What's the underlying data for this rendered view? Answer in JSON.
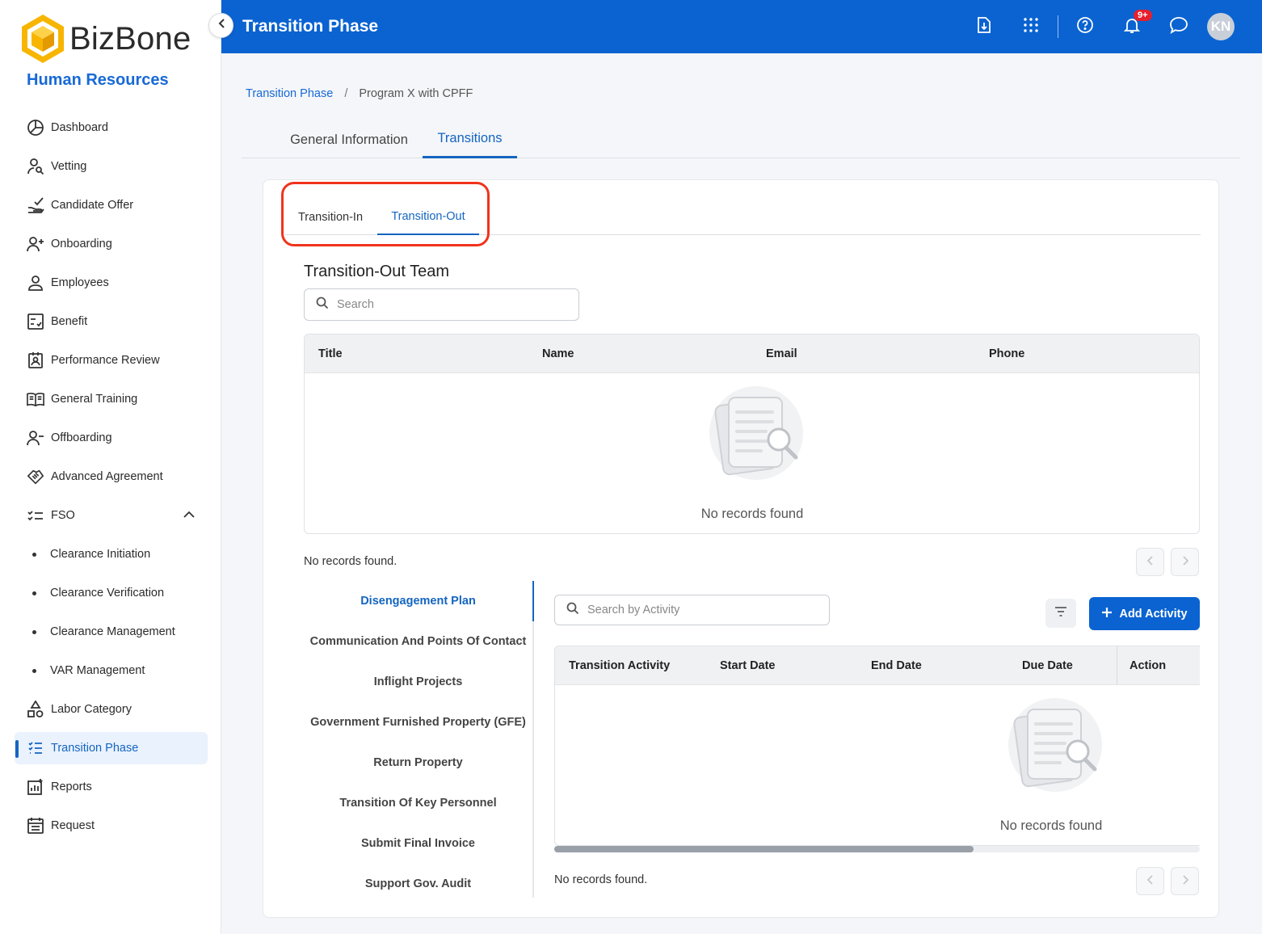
{
  "app": {
    "brand": "BizBone",
    "module": "Human Resources",
    "page_title": "Transition Phase",
    "user_initials": "KN",
    "notification_count": "9+"
  },
  "sidebar": {
    "items": [
      {
        "label": "Dashboard",
        "icon": "dashboard-icon"
      },
      {
        "label": "Vetting",
        "icon": "user-search-icon"
      },
      {
        "label": "Candidate Offer",
        "icon": "hand-check-icon"
      },
      {
        "label": "Onboarding",
        "icon": "user-plus-icon"
      },
      {
        "label": "Employees",
        "icon": "user-icon"
      },
      {
        "label": "Benefit",
        "icon": "checklist-box-icon"
      },
      {
        "label": "Performance Review",
        "icon": "badge-review-icon"
      },
      {
        "label": "General Training",
        "icon": "book-icon"
      },
      {
        "label": "Offboarding",
        "icon": "user-minus-icon"
      },
      {
        "label": "Advanced Agreement",
        "icon": "handshake-icon"
      },
      {
        "label": "FSO",
        "icon": "list-check-icon"
      },
      {
        "label": "Clearance Initiation"
      },
      {
        "label": "Clearance Verification"
      },
      {
        "label": "Clearance Management"
      },
      {
        "label": "VAR Management"
      },
      {
        "label": "Labor Category",
        "icon": "shapes-icon"
      },
      {
        "label": "Transition Phase",
        "icon": "list-icon"
      },
      {
        "label": "Reports",
        "icon": "chart-icon"
      },
      {
        "label": "Request",
        "icon": "calendar-list-icon"
      }
    ]
  },
  "breadcrumb": {
    "root": "Transition Phase",
    "current": "Program X with CPFF"
  },
  "tabs": {
    "general": "General Information",
    "transitions": "Transitions"
  },
  "subtabs": {
    "in": "Transition-In",
    "out": "Transition-Out"
  },
  "team": {
    "title": "Transition-Out Team",
    "search_placeholder": "Search",
    "columns": [
      "Title",
      "Name",
      "Email",
      "Phone"
    ],
    "empty_text": "No records found",
    "footer_text": "No records found."
  },
  "plan": {
    "sections": [
      "Disengagement Plan",
      "Communication And Points Of Contact",
      "Inflight Projects",
      "Government Furnished Property (GFE)",
      "Return Property",
      "Transition Of Key Personnel",
      "Submit Final Invoice",
      "Support Gov. Audit"
    ],
    "search_placeholder": "Search by Activity",
    "add_label": "Add Activity",
    "columns": [
      "Transition Activity",
      "Start Date",
      "End Date",
      "Due Date",
      "Action"
    ],
    "empty_text": "No records found",
    "footer_text": "No records found."
  },
  "colors": {
    "primary": "#0a63d1",
    "accent_text": "#1565c0",
    "highlight": "#f0341c",
    "badge": "#e5202e"
  }
}
